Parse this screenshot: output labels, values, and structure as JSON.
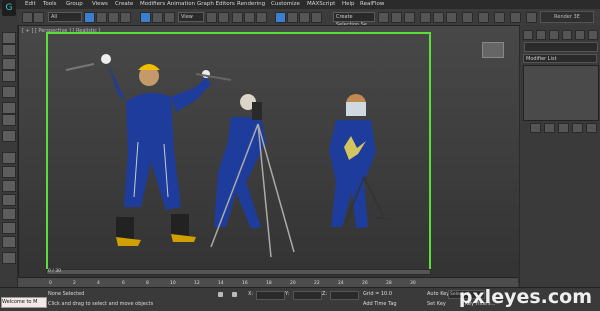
{
  "app": {
    "logo_glyph": "G",
    "render_label": "Render 3E"
  },
  "menu": [
    "Edit",
    "Tools",
    "Group",
    "Views",
    "Create",
    "Modifiers",
    "Animation",
    "Graph Editors",
    "Rendering",
    "Customize",
    "MAXScript",
    "Help",
    "RealFlow"
  ],
  "toolbar": {
    "selection_filter": "All",
    "reference_coord": "View",
    "named_selection": "Create Selection Se"
  },
  "viewport": {
    "label": "[ + ] [ Perspective ] [ Realistic ]",
    "safe_frame_color": "#5ade3a",
    "figures": [
      "hammer-worker",
      "surveyor-worker",
      "welder-worker"
    ]
  },
  "command_panel": {
    "modifier_list": "Modifier List"
  },
  "time_slider": {
    "value": "0 / 30"
  },
  "track_ticks": [
    "0",
    "2",
    "4",
    "6",
    "8",
    "10",
    "12",
    "14",
    "16",
    "18",
    "20",
    "22",
    "24",
    "26",
    "28",
    "30"
  ],
  "status": {
    "maxscript": "Welcome to M",
    "selection": "None Selected",
    "prompt": "Click and drag to select and move objects",
    "x_label": "X:",
    "y_label": "Y:",
    "z_label": "Z:",
    "grid": "Grid = 10.0",
    "add_time_tag": "Add Time Tag",
    "auto_key": "Auto Key",
    "auto_key_value": "Selected",
    "set_key": "Set Key",
    "key_filters": "Key Filters..."
  },
  "watermark": "pxleyes.com"
}
